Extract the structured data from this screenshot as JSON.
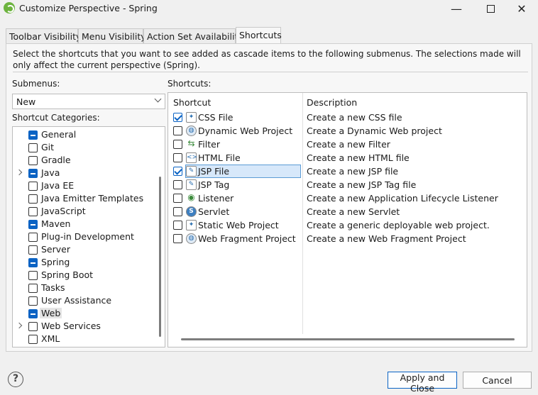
{
  "window": {
    "title": "Customize Perspective - Spring",
    "icon": "spring-leaf-icon"
  },
  "tabs": [
    {
      "label": "Toolbar Visibility"
    },
    {
      "label": "Menu Visibility"
    },
    {
      "label": "Action Set Availability"
    },
    {
      "label": "Shortcuts",
      "active": true
    }
  ],
  "instructions": "Select the shortcuts that you want to see added as cascade items to the following submenus. The selections made will only affect the current perspective (Spring).",
  "submenus": {
    "label": "Submenus:",
    "selected": "New"
  },
  "categories": {
    "label": "Shortcut Categories:",
    "items": [
      {
        "label": "General",
        "state": "partial",
        "expandable": false
      },
      {
        "label": "Git",
        "state": "unchecked",
        "expandable": false
      },
      {
        "label": "Gradle",
        "state": "unchecked",
        "expandable": false
      },
      {
        "label": "Java",
        "state": "partial",
        "expandable": true
      },
      {
        "label": "Java EE",
        "state": "unchecked",
        "expandable": false
      },
      {
        "label": "Java Emitter Templates",
        "state": "unchecked",
        "expandable": false
      },
      {
        "label": "JavaScript",
        "state": "unchecked",
        "expandable": false
      },
      {
        "label": "Maven",
        "state": "partial",
        "expandable": false
      },
      {
        "label": "Plug-in Development",
        "state": "unchecked",
        "expandable": false
      },
      {
        "label": "Server",
        "state": "unchecked",
        "expandable": false
      },
      {
        "label": "Spring",
        "state": "partial",
        "expandable": false
      },
      {
        "label": "Spring Boot",
        "state": "unchecked",
        "expandable": false
      },
      {
        "label": "Tasks",
        "state": "unchecked",
        "expandable": false
      },
      {
        "label": "User Assistance",
        "state": "unchecked",
        "expandable": false
      },
      {
        "label": "Web",
        "state": "partial",
        "expandable": false,
        "selected": true
      },
      {
        "label": "Web Services",
        "state": "unchecked",
        "expandable": true
      },
      {
        "label": "XML",
        "state": "unchecked",
        "expandable": false
      }
    ]
  },
  "shortcuts": {
    "label": "Shortcuts:",
    "columns": [
      "Shortcut",
      "Description"
    ],
    "rows": [
      {
        "name": "CSS File",
        "description": "Create a new CSS file",
        "checked": true,
        "icon": "css-file-icon"
      },
      {
        "name": "Dynamic Web Project",
        "description": "Create a Dynamic Web project",
        "checked": false,
        "icon": "web-project-icon"
      },
      {
        "name": "Filter",
        "description": "Create a new Filter",
        "checked": false,
        "icon": "filter-icon"
      },
      {
        "name": "HTML File",
        "description": "Create a new HTML file",
        "checked": false,
        "icon": "html-file-icon"
      },
      {
        "name": "JSP File",
        "description": "Create a new JSP file",
        "checked": true,
        "icon": "jsp-file-icon",
        "selected": true
      },
      {
        "name": "JSP Tag",
        "description": "Create a new JSP Tag file",
        "checked": false,
        "icon": "jsp-tag-icon"
      },
      {
        "name": "Listener",
        "description": "Create a new Application Lifecycle Listener",
        "checked": false,
        "icon": "listener-icon"
      },
      {
        "name": "Servlet",
        "description": "Create a new Servlet",
        "checked": false,
        "icon": "servlet-icon"
      },
      {
        "name": "Static Web Project",
        "description": "Create a generic deployable web project.",
        "checked": false,
        "icon": "static-web-project-icon"
      },
      {
        "name": "Web Fragment Project",
        "description": "Create a new Web Fragment Project",
        "checked": false,
        "icon": "web-fragment-project-icon"
      }
    ]
  },
  "buttons": {
    "apply": "Apply and Close",
    "cancel": "Cancel",
    "help": "?"
  }
}
